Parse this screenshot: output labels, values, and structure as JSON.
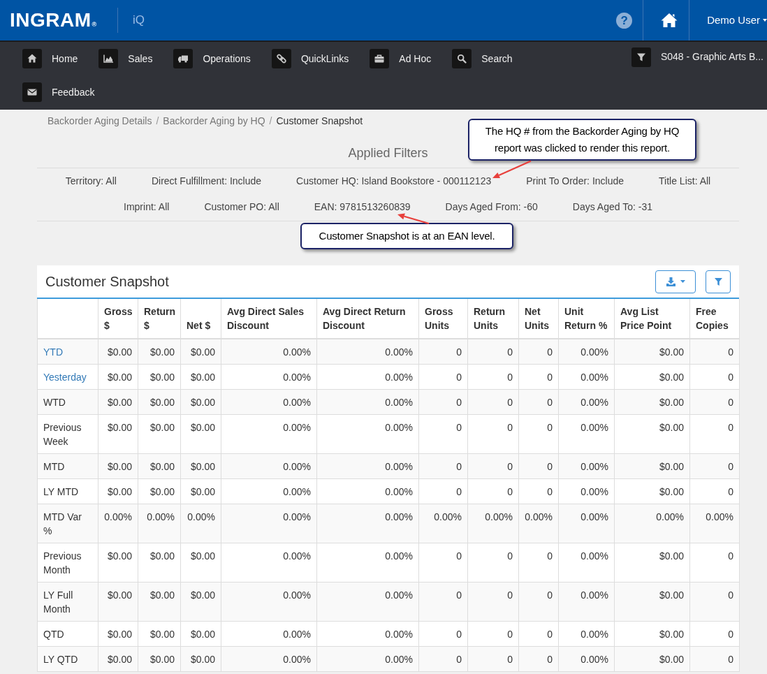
{
  "top_bar": {
    "logo": {
      "text": "INGRAM",
      "mark": "®"
    },
    "app_name": "iQ",
    "help_glyph": "?",
    "user": "Demo User"
  },
  "nav": {
    "rows": [
      [
        {
          "kind": "home",
          "label": "Home"
        },
        {
          "kind": "sales",
          "label": "Sales"
        },
        {
          "kind": "operations",
          "label": "Operations"
        },
        {
          "kind": "links",
          "label": "QuickLinks"
        },
        {
          "kind": "adhoc",
          "label": "Ad Hoc"
        },
        {
          "kind": "search",
          "label": "Search"
        }
      ],
      [
        {
          "kind": "feedback",
          "label": "Feedback"
        }
      ]
    ],
    "account_filter": "S048 - Graphic Arts B..."
  },
  "breadcrumb": [
    {
      "kind": "link",
      "label": "Backorder Aging Details"
    },
    {
      "kind": "separator",
      "label": "/"
    },
    {
      "kind": "link",
      "label": "Backorder Aging by HQ"
    },
    {
      "kind": "separator",
      "label": "/"
    },
    {
      "kind": "current",
      "label": "Customer Snapshot"
    }
  ],
  "applied_filters": {
    "title": "Applied Filters",
    "items": [
      "Territory: All",
      "Direct Fulfillment: Include",
      "Customer HQ: Island Bookstore - 000112123",
      "Print To Order: Include",
      "Title List: All",
      "Imprint: All",
      "Customer PO: All",
      "EAN: 9781513260839",
      "Days Aged From: -60",
      "Days Aged To: -31"
    ]
  },
  "annotations": [
    {
      "text": "The HQ # from the Backorder Aging by HQ report was clicked to render this report."
    },
    {
      "text": "Customer Snapshot is at an EAN level."
    }
  ],
  "panel": {
    "title": "Customer Snapshot",
    "table": {
      "columns": [
        "Gross $",
        "Return $",
        "Net $",
        "Avg Direct Sales Discount",
        "Avg Direct Return Discount",
        "Gross Units",
        "Return Units",
        "Net Units",
        "Unit Return %",
        "Avg List Price Point",
        "Free Copies"
      ],
      "rows": [
        {
          "label": "YTD",
          "kind": "link",
          "cells": [
            "$0.00",
            "$0.00",
            "$0.00",
            "0.00%",
            "0.00%",
            "0",
            "0",
            "0",
            "0.00%",
            "$0.00",
            "0"
          ]
        },
        {
          "label": "Yesterday",
          "kind": "link",
          "cells": [
            "$0.00",
            "$0.00",
            "$0.00",
            "0.00%",
            "0.00%",
            "0",
            "0",
            "0",
            "0.00%",
            "$0.00",
            "0"
          ]
        },
        {
          "label": "WTD",
          "kind": "text",
          "cells": [
            "$0.00",
            "$0.00",
            "$0.00",
            "0.00%",
            "0.00%",
            "0",
            "0",
            "0",
            "0.00%",
            "$0.00",
            "0"
          ]
        },
        {
          "label": "Previous Week",
          "kind": "text",
          "cells": [
            "$0.00",
            "$0.00",
            "$0.00",
            "0.00%",
            "0.00%",
            "0",
            "0",
            "0",
            "0.00%",
            "$0.00",
            "0"
          ]
        },
        {
          "label": "MTD",
          "kind": "text",
          "cells": [
            "$0.00",
            "$0.00",
            "$0.00",
            "0.00%",
            "0.00%",
            "0",
            "0",
            "0",
            "0.00%",
            "$0.00",
            "0"
          ]
        },
        {
          "label": "LY MTD",
          "kind": "text",
          "cells": [
            "$0.00",
            "$0.00",
            "$0.00",
            "0.00%",
            "0.00%",
            "0",
            "0",
            "0",
            "0.00%",
            "$0.00",
            "0"
          ]
        },
        {
          "label": "MTD Var %",
          "kind": "text",
          "cells": [
            "0.00%",
            "0.00%",
            "0.00%",
            "0.00%",
            "0.00%",
            "0.00%",
            "0.00%",
            "0.00%",
            "0.00%",
            "0.00%",
            "0.00%"
          ]
        },
        {
          "label": "Previous Month",
          "kind": "text",
          "cells": [
            "$0.00",
            "$0.00",
            "$0.00",
            "0.00%",
            "0.00%",
            "0",
            "0",
            "0",
            "0.00%",
            "$0.00",
            "0"
          ]
        },
        {
          "label": "LY Full Month",
          "kind": "text",
          "cells": [
            "$0.00",
            "$0.00",
            "$0.00",
            "0.00%",
            "0.00%",
            "0",
            "0",
            "0",
            "0.00%",
            "$0.00",
            "0"
          ]
        },
        {
          "label": "QTD",
          "kind": "text",
          "cells": [
            "$0.00",
            "$0.00",
            "$0.00",
            "0.00%",
            "0.00%",
            "0",
            "0",
            "0",
            "0.00%",
            "$0.00",
            "0"
          ]
        },
        {
          "label": "LY QTD",
          "kind": "text",
          "cells": [
            "$0.00",
            "$0.00",
            "$0.00",
            "0.00%",
            "0.00%",
            "0",
            "0",
            "0",
            "0.00%",
            "$0.00",
            "0"
          ]
        }
      ]
    }
  }
}
